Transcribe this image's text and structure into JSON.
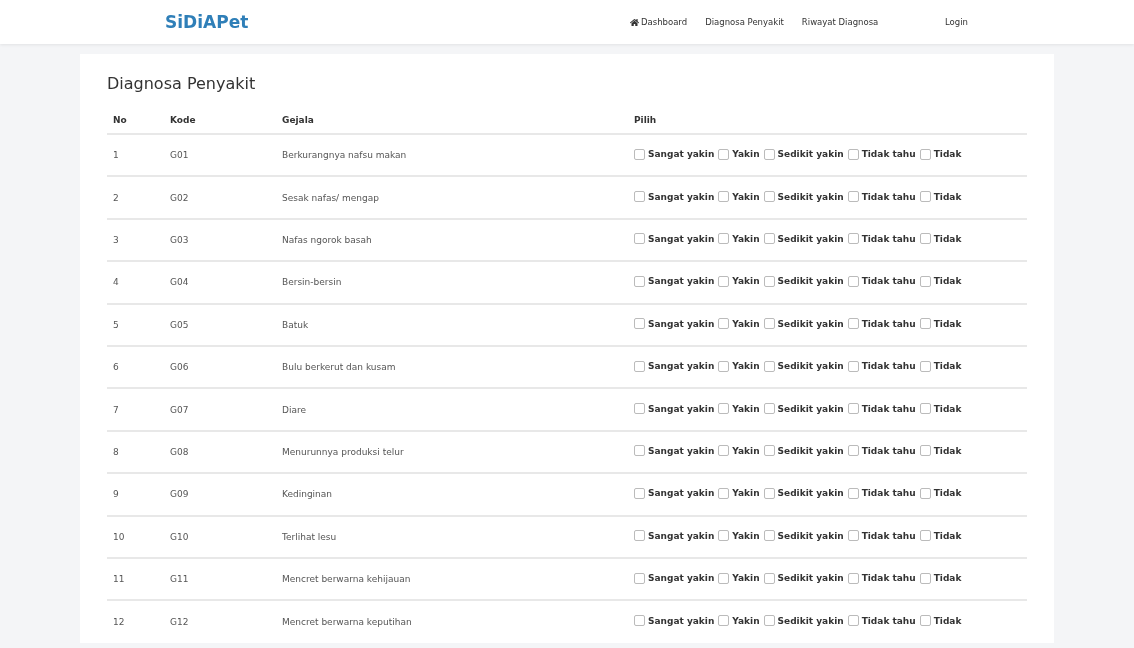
{
  "navbar": {
    "brand": "SiDiAPet",
    "links": [
      {
        "label": "Dashboard",
        "kind": "home"
      },
      {
        "label": "Diagnosa Penyakit",
        "kind": "plain"
      },
      {
        "label": "Riwayat Diagnosa",
        "kind": "plain"
      }
    ],
    "login": "Login"
  },
  "page": {
    "title": "Diagnosa Penyakit"
  },
  "table": {
    "columns": [
      "No",
      "Kode",
      "Gejala",
      "Pilih"
    ],
    "rows": [
      {
        "no": "1",
        "kode": "G01",
        "gejala": "Berkurangnya nafsu makan",
        "choices": [
          {
            "label": "Sangat yakin",
            "checked": false
          },
          {
            "label": "Yakin",
            "checked": false
          },
          {
            "label": "Sedikit yakin",
            "checked": false
          },
          {
            "label": "Tidak tahu",
            "checked": false
          },
          {
            "label": "Tidak",
            "checked": false
          }
        ]
      },
      {
        "no": "2",
        "kode": "G02",
        "gejala": "Sesak nafas/ mengap",
        "choices": [
          {
            "label": "Sangat yakin",
            "checked": false
          },
          {
            "label": "Yakin",
            "checked": false
          },
          {
            "label": "Sedikit yakin",
            "checked": false
          },
          {
            "label": "Tidak tahu",
            "checked": false
          },
          {
            "label": "Tidak",
            "checked": false
          }
        ]
      },
      {
        "no": "3",
        "kode": "G03",
        "gejala": "Nafas ngorok basah",
        "choices": [
          {
            "label": "Sangat yakin",
            "checked": false
          },
          {
            "label": "Yakin",
            "checked": false
          },
          {
            "label": "Sedikit yakin",
            "checked": false
          },
          {
            "label": "Tidak tahu",
            "checked": false
          },
          {
            "label": "Tidak",
            "checked": false
          }
        ]
      },
      {
        "no": "4",
        "kode": "G04",
        "gejala": "Bersin-bersin",
        "choices": [
          {
            "label": "Sangat yakin",
            "checked": false
          },
          {
            "label": "Yakin",
            "checked": false
          },
          {
            "label": "Sedikit yakin",
            "checked": false
          },
          {
            "label": "Tidak tahu",
            "checked": false
          },
          {
            "label": "Tidak",
            "checked": false
          }
        ]
      },
      {
        "no": "5",
        "kode": "G05",
        "gejala": "Batuk",
        "choices": [
          {
            "label": "Sangat yakin",
            "checked": false
          },
          {
            "label": "Yakin",
            "checked": false
          },
          {
            "label": "Sedikit yakin",
            "checked": false
          },
          {
            "label": "Tidak tahu",
            "checked": false
          },
          {
            "label": "Tidak",
            "checked": false
          }
        ]
      },
      {
        "no": "6",
        "kode": "G06",
        "gejala": "Bulu berkerut dan kusam",
        "choices": [
          {
            "label": "Sangat yakin",
            "checked": false
          },
          {
            "label": "Yakin",
            "checked": false
          },
          {
            "label": "Sedikit yakin",
            "checked": false
          },
          {
            "label": "Tidak tahu",
            "checked": false
          },
          {
            "label": "Tidak",
            "checked": false
          }
        ]
      },
      {
        "no": "7",
        "kode": "G07",
        "gejala": "Diare",
        "choices": [
          {
            "label": "Sangat yakin",
            "checked": false
          },
          {
            "label": "Yakin",
            "checked": false
          },
          {
            "label": "Sedikit yakin",
            "checked": false
          },
          {
            "label": "Tidak tahu",
            "checked": false
          },
          {
            "label": "Tidak",
            "checked": false
          }
        ]
      },
      {
        "no": "8",
        "kode": "G08",
        "gejala": "Menurunnya produksi telur",
        "choices": [
          {
            "label": "Sangat yakin",
            "checked": false
          },
          {
            "label": "Yakin",
            "checked": false
          },
          {
            "label": "Sedikit yakin",
            "checked": false
          },
          {
            "label": "Tidak tahu",
            "checked": false
          },
          {
            "label": "Tidak",
            "checked": false
          }
        ]
      },
      {
        "no": "9",
        "kode": "G09",
        "gejala": "Kedinginan",
        "choices": [
          {
            "label": "Sangat yakin",
            "checked": false
          },
          {
            "label": "Yakin",
            "checked": false
          },
          {
            "label": "Sedikit yakin",
            "checked": false
          },
          {
            "label": "Tidak tahu",
            "checked": false
          },
          {
            "label": "Tidak",
            "checked": false
          }
        ]
      },
      {
        "no": "10",
        "kode": "G10",
        "gejala": "Terlihat lesu",
        "choices": [
          {
            "label": "Sangat yakin",
            "checked": false
          },
          {
            "label": "Yakin",
            "checked": false
          },
          {
            "label": "Sedikit yakin",
            "checked": false
          },
          {
            "label": "Tidak tahu",
            "checked": false
          },
          {
            "label": "Tidak",
            "checked": false
          }
        ]
      },
      {
        "no": "11",
        "kode": "G11",
        "gejala": "Mencret berwarna kehijauan",
        "choices": [
          {
            "label": "Sangat yakin",
            "checked": false
          },
          {
            "label": "Yakin",
            "checked": false
          },
          {
            "label": "Sedikit yakin",
            "checked": false
          },
          {
            "label": "Tidak tahu",
            "checked": false
          },
          {
            "label": "Tidak",
            "checked": false
          }
        ]
      },
      {
        "no": "12",
        "kode": "G12",
        "gejala": "Mencret berwarna keputihan",
        "choices": [
          {
            "label": "Sangat yakin",
            "checked": false
          },
          {
            "label": "Yakin",
            "checked": false
          },
          {
            "label": "Sedikit yakin",
            "checked": false
          },
          {
            "label": "Tidak tahu",
            "checked": false
          },
          {
            "label": "Tidak",
            "checked": false
          }
        ]
      }
    ]
  }
}
